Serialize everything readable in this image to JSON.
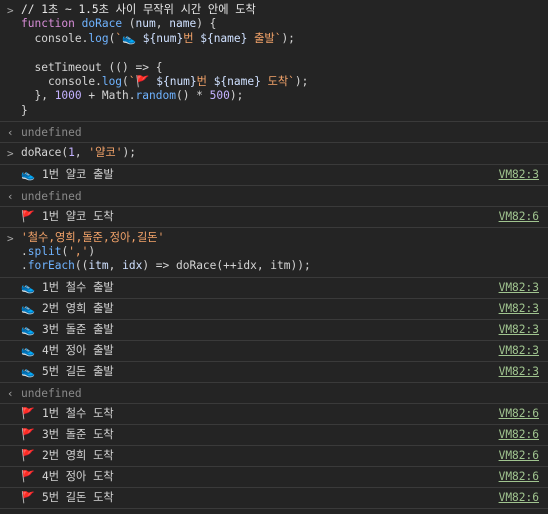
{
  "entry1": {
    "lines": [
      "// 1초 ~ 1.5초 사이 무작위 시간 안에 도착",
      "function doRace (num, name) {",
      "  console.log(`👟 ${num}번 ${name} 출발`);",
      "",
      "  setTimeout (() => {",
      "    console.log(`🚩 ${num}번 ${name} 도착`);",
      "  }, 1000 + Math.random() * 500);",
      "}"
    ]
  },
  "result1": "undefined",
  "entry2": {
    "lines": [
      "doRace(1, '얄코');"
    ]
  },
  "log1": {
    "icon": "👟",
    "text": "1번 얄코 출발",
    "source": "VM82:3"
  },
  "result2": "undefined",
  "log2": {
    "icon": "🚩",
    "text": "1번 얄코 도착",
    "source": "VM82:6"
  },
  "entry3": {
    "lines": [
      "'철수,영희,돌준,정아,길돈'",
      ".split(',')",
      ".forEach((itm, idx) => doRace(++idx, itm));"
    ]
  },
  "logs3": [
    {
      "icon": "👟",
      "text": "1번 철수 출발",
      "source": "VM82:3"
    },
    {
      "icon": "👟",
      "text": "2번 영희 출발",
      "source": "VM82:3"
    },
    {
      "icon": "👟",
      "text": "3번 돌준 출발",
      "source": "VM82:3"
    },
    {
      "icon": "👟",
      "text": "4번 정아 출발",
      "source": "VM82:3"
    },
    {
      "icon": "👟",
      "text": "5번 길돈 출발",
      "source": "VM82:3"
    }
  ],
  "result3": "undefined",
  "logs4": [
    {
      "icon": "🚩",
      "text": "1번 철수 도착",
      "source": "VM82:6"
    },
    {
      "icon": "🚩",
      "text": "3번 돌준 도착",
      "source": "VM82:6"
    },
    {
      "icon": "🚩",
      "text": "2번 영희 도착",
      "source": "VM82:6"
    },
    {
      "icon": "🚩",
      "text": "4번 정아 도착",
      "source": "VM82:6"
    },
    {
      "icon": "🚩",
      "text": "5번 길돈 도착",
      "source": "VM82:6"
    }
  ],
  "prompt_glyph": ">",
  "result_glyph": "‹"
}
